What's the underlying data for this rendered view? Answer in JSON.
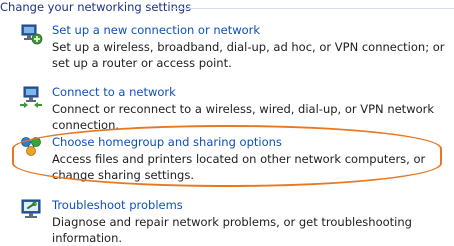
{
  "section": {
    "title": "Change your networking settings"
  },
  "tasks": [
    {
      "icon": "new-connection-icon",
      "link": "Set up a new connection or network",
      "description": "Set up a wireless, broadband, dial-up, ad hoc, or VPN connection; or set up a router or access point."
    },
    {
      "icon": "connect-network-icon",
      "link": "Connect to a network",
      "description": "Connect or reconnect to a wireless, wired, dial-up, or VPN network connection."
    },
    {
      "icon": "homegroup-sharing-icon",
      "link": "Choose homegroup and sharing options",
      "description": "Access files and printers located on other network computers, or change sharing settings."
    },
    {
      "icon": "troubleshoot-icon",
      "link": "Troubleshoot problems",
      "description": "Diagnose and repair network problems, or get troubleshooting information."
    }
  ],
  "colors": {
    "link": "#0e4fc0",
    "heading": "#1e3287",
    "highlight": "#e87722"
  }
}
